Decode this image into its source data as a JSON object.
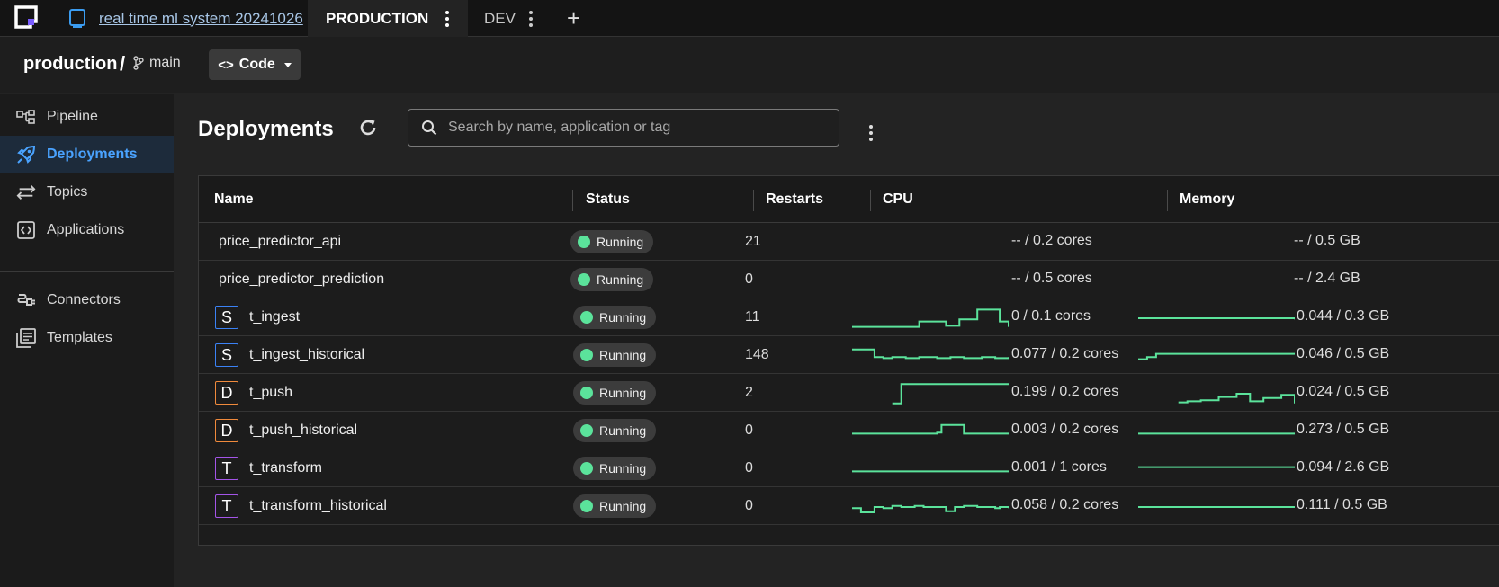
{
  "tabs": {
    "project": {
      "label": "real time ml system 20241026"
    },
    "production": {
      "label": "PRODUCTION"
    },
    "dev": {
      "label": "DEV"
    },
    "add_label": "+"
  },
  "breadcrumb": {
    "root": "production",
    "separator": "/",
    "branch": "main",
    "code_button": "Code"
  },
  "sidebar": {
    "items": [
      {
        "label": "Pipeline",
        "icon": "pipeline-icon",
        "active": false
      },
      {
        "label": "Deployments",
        "icon": "rocket-icon",
        "active": true
      },
      {
        "label": "Topics",
        "icon": "swap-arrows-icon",
        "active": false
      },
      {
        "label": "Applications",
        "icon": "code-window-icon",
        "active": false
      },
      {
        "label": "Connectors",
        "icon": "plug-icon",
        "active": false
      },
      {
        "label": "Templates",
        "icon": "templates-icon",
        "active": false
      }
    ]
  },
  "main": {
    "title": "Deployments",
    "search_placeholder": "Search by name, application or tag"
  },
  "colors": {
    "accent": "#4aa3ff",
    "running": "#5be39b",
    "sparkline": "#5be39b",
    "badge_S": "#3b82f6",
    "badge_D": "#f08a3c",
    "badge_T": "#a455e8"
  },
  "table": {
    "headers": {
      "name": "Name",
      "status": "Status",
      "restarts": "Restarts",
      "cpu": "CPU",
      "memory": "Memory"
    },
    "rows": [
      {
        "type": "",
        "name": "price_predictor_api",
        "status": "Running",
        "restarts": "21",
        "cpu": "-- / 0.2 cores",
        "memory": "-- / 0.5 GB",
        "cpu_trend": [],
        "mem_trend": []
      },
      {
        "type": "",
        "name": "price_predictor_prediction",
        "status": "Running",
        "restarts": "0",
        "cpu": "-- / 0.5 cores",
        "memory": "-- / 2.4 GB",
        "cpu_trend": [],
        "mem_trend": []
      },
      {
        "type": "S",
        "name": "t_ingest",
        "status": "Running",
        "restarts": "11",
        "cpu": "0 / 0.1 cores",
        "memory": "0.044 / 0.3 GB",
        "cpu_trend": [
          0.1,
          0.1,
          0.1,
          0.1,
          0.1,
          0.1,
          0.1,
          0.1,
          0.1,
          0.1,
          0.1,
          0.1,
          0.1,
          0.1,
          0.1,
          0.35,
          0.35,
          0.35,
          0.35,
          0.35,
          0.35,
          0.15,
          0.15,
          0.15,
          0.45,
          0.45,
          0.45,
          0.45,
          0.9,
          0.9,
          0.9,
          0.9,
          0.9,
          0.35,
          0.35,
          0.1
        ],
        "mem_trend": [
          0.5,
          0.5,
          0.5,
          0.5,
          0.5,
          0.5,
          0.5,
          0.5,
          0.5,
          0.5,
          0.5,
          0.5,
          0.5,
          0.5,
          0.5,
          0.5,
          0.5,
          0.5,
          0.5,
          0.5,
          0.5,
          0.5,
          0.5,
          0.5,
          0.5,
          0.5,
          0.5,
          0.5,
          0.5,
          0.5,
          0.5,
          0.5,
          0.5,
          0.5,
          0.5,
          0.45
        ]
      },
      {
        "type": "S",
        "name": "t_ingest_historical",
        "status": "Running",
        "restarts": "148",
        "cpu": "0.077 / 0.2 cores",
        "memory": "0.046 / 0.5 GB",
        "cpu_trend": [
          0.8,
          0.8,
          0.8,
          0.8,
          0.8,
          0.45,
          0.45,
          0.4,
          0.4,
          0.45,
          0.45,
          0.45,
          0.4,
          0.4,
          0.4,
          0.45,
          0.45,
          0.45,
          0.45,
          0.4,
          0.4,
          0.4,
          0.45,
          0.45,
          0.45,
          0.4,
          0.4,
          0.4,
          0.4,
          0.45,
          0.45,
          0.45,
          0.4,
          0.4,
          0.4,
          0.45
        ],
        "mem_trend": [
          0.35,
          0.35,
          0.45,
          0.45,
          0.6,
          0.6,
          0.6,
          0.6,
          0.6,
          0.6,
          0.6,
          0.6,
          0.6,
          0.6,
          0.6,
          0.6,
          0.6,
          0.6,
          0.6,
          0.6,
          0.6,
          0.6,
          0.6,
          0.6,
          0.6,
          0.6,
          0.6,
          0.6,
          0.6,
          0.6,
          0.6,
          0.6,
          0.6,
          0.6,
          0.6,
          0.6
        ]
      },
      {
        "type": "D",
        "name": "t_push",
        "status": "Running",
        "restarts": "2",
        "cpu": "0.199 / 0.2 cores",
        "memory": "0.024 / 0.5 GB",
        "cpu_trend": [
          null,
          null,
          null,
          null,
          null,
          null,
          null,
          null,
          null,
          0.05,
          0.05,
          0.95,
          0.95,
          0.95,
          0.95,
          0.95,
          0.95,
          0.95,
          0.95,
          0.95,
          0.95,
          0.95,
          0.95,
          0.95,
          0.95,
          0.95,
          0.95,
          0.95,
          0.95,
          0.95,
          0.95,
          0.95,
          0.95,
          0.95,
          0.95,
          0.95
        ],
        "mem_trend": [
          null,
          null,
          null,
          null,
          null,
          null,
          null,
          null,
          null,
          0.1,
          0.1,
          0.15,
          0.15,
          0.15,
          0.2,
          0.2,
          0.2,
          0.2,
          0.35,
          0.35,
          0.35,
          0.35,
          0.5,
          0.5,
          0.5,
          0.15,
          0.15,
          0.15,
          0.3,
          0.3,
          0.3,
          0.3,
          0.45,
          0.45,
          0.45,
          0.05
        ]
      },
      {
        "type": "D",
        "name": "t_push_historical",
        "status": "Running",
        "restarts": "0",
        "cpu": "0.003 / 0.2 cores",
        "memory": "0.273 / 0.5 GB",
        "cpu_trend": [
          0.4,
          0.4,
          0.4,
          0.4,
          0.4,
          0.4,
          0.4,
          0.4,
          0.4,
          0.4,
          0.4,
          0.4,
          0.4,
          0.4,
          0.4,
          0.4,
          0.4,
          0.4,
          0.4,
          0.45,
          0.8,
          0.8,
          0.8,
          0.8,
          0.8,
          0.4,
          0.4,
          0.4,
          0.4,
          0.4,
          0.4,
          0.4,
          0.4,
          0.4,
          0.4,
          0.4
        ],
        "mem_trend": [
          0.4,
          0.4,
          0.4,
          0.4,
          0.4,
          0.4,
          0.4,
          0.4,
          0.4,
          0.4,
          0.4,
          0.4,
          0.4,
          0.4,
          0.4,
          0.4,
          0.4,
          0.4,
          0.4,
          0.4,
          0.4,
          0.4,
          0.4,
          0.4,
          0.4,
          0.4,
          0.4,
          0.4,
          0.4,
          0.4,
          0.4,
          0.4,
          0.4,
          0.4,
          0.4,
          0.4
        ]
      },
      {
        "type": "T",
        "name": "t_transform",
        "status": "Running",
        "restarts": "0",
        "cpu": "0.001 / 1 cores",
        "memory": "0.094 / 2.6 GB",
        "cpu_trend": [
          0.4,
          0.4,
          0.4,
          0.4,
          0.4,
          0.4,
          0.4,
          0.4,
          0.4,
          0.4,
          0.4,
          0.4,
          0.4,
          0.4,
          0.4,
          0.4,
          0.4,
          0.4,
          0.4,
          0.4,
          0.4,
          0.4,
          0.4,
          0.4,
          0.4,
          0.4,
          0.4,
          0.4,
          0.4,
          0.4,
          0.4,
          0.4,
          0.4,
          0.4,
          0.4,
          0.4
        ],
        "mem_trend": [
          0.6,
          0.6,
          0.6,
          0.6,
          0.6,
          0.6,
          0.6,
          0.6,
          0.6,
          0.6,
          0.6,
          0.6,
          0.6,
          0.6,
          0.6,
          0.6,
          0.6,
          0.6,
          0.6,
          0.6,
          0.6,
          0.6,
          0.6,
          0.6,
          0.6,
          0.6,
          0.6,
          0.6,
          0.6,
          0.6,
          0.6,
          0.6,
          0.6,
          0.6,
          0.6,
          0.6
        ]
      },
      {
        "type": "T",
        "name": "t_transform_historical",
        "status": "Running",
        "restarts": "0",
        "cpu": "0.058 / 0.2 cores",
        "memory": "0.111 / 0.5 GB",
        "cpu_trend": [
          0.45,
          0.45,
          0.25,
          0.25,
          0.25,
          0.5,
          0.5,
          0.45,
          0.45,
          0.55,
          0.55,
          0.5,
          0.5,
          0.5,
          0.55,
          0.55,
          0.5,
          0.5,
          0.5,
          0.5,
          0.5,
          0.3,
          0.3,
          0.5,
          0.5,
          0.55,
          0.55,
          0.55,
          0.5,
          0.5,
          0.5,
          0.5,
          0.45,
          0.5,
          0.5,
          0.45
        ],
        "mem_trend": [
          0.5,
          0.5,
          0.5,
          0.5,
          0.5,
          0.5,
          0.5,
          0.5,
          0.5,
          0.5,
          0.5,
          0.5,
          0.5,
          0.5,
          0.5,
          0.5,
          0.5,
          0.5,
          0.5,
          0.5,
          0.5,
          0.5,
          0.5,
          0.5,
          0.5,
          0.5,
          0.5,
          0.5,
          0.5,
          0.5,
          0.5,
          0.5,
          0.5,
          0.5,
          0.5,
          0.5
        ]
      }
    ]
  }
}
